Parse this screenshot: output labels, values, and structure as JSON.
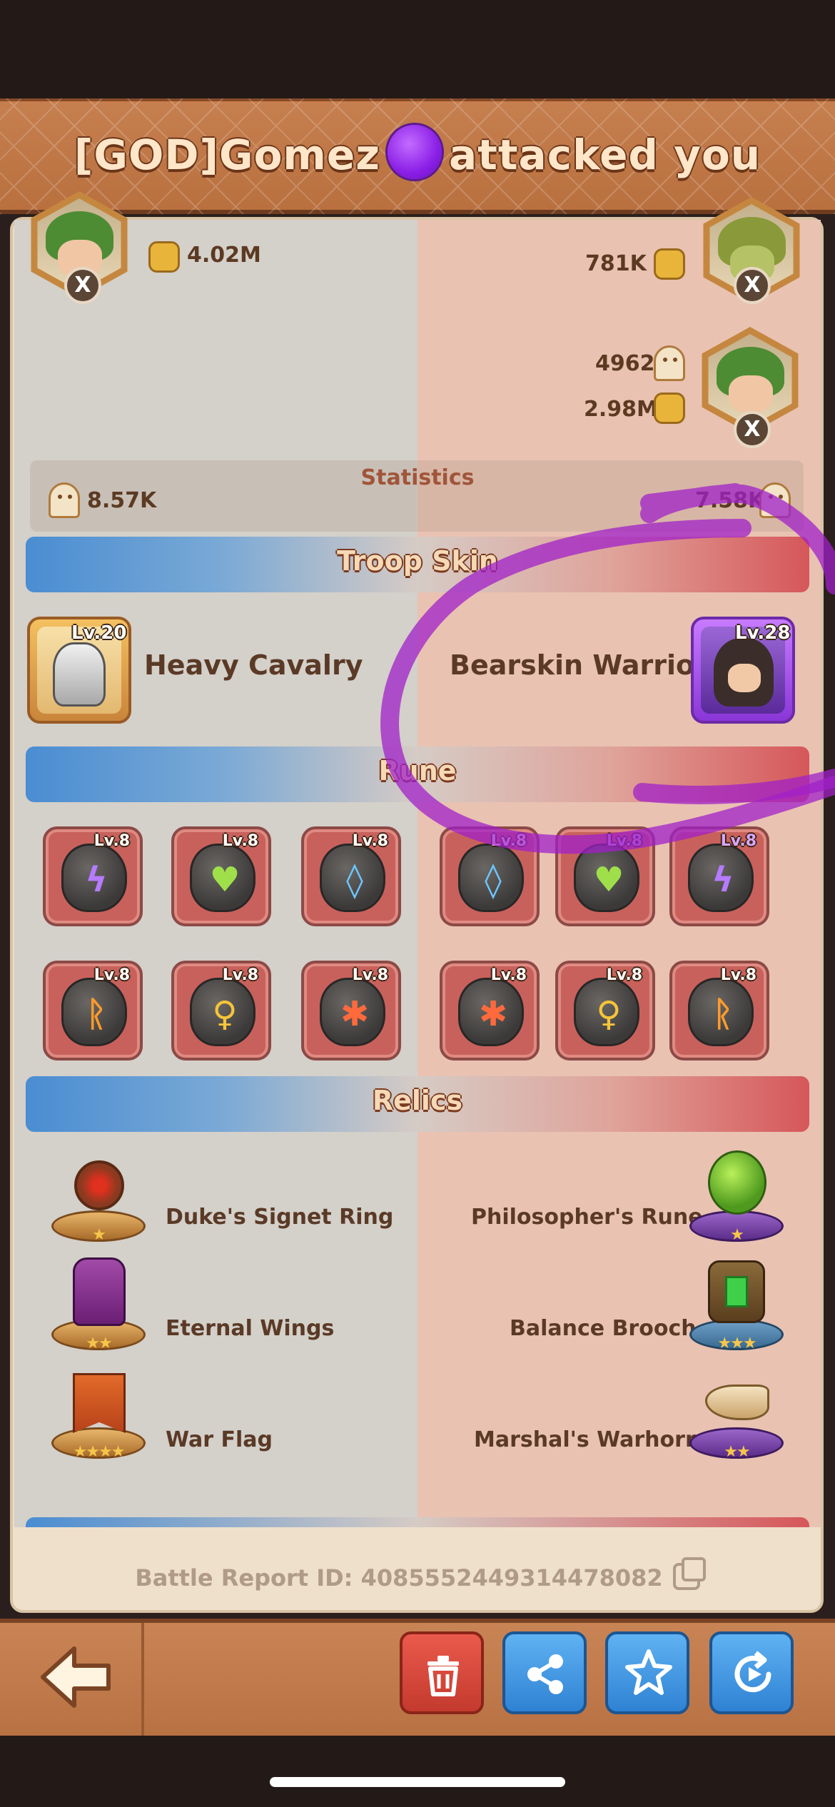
{
  "header": {
    "title_prefix": "[GOD]Gomez",
    "title_suffix": "attacked you"
  },
  "attacker_hero": {
    "power": "4.02M"
  },
  "defender_heroes": [
    {
      "power": "781K"
    },
    {
      "troops": "4962",
      "power": "2.98M"
    }
  ],
  "statistics": {
    "title": "Statistics",
    "left_value": "8.57K",
    "right_value": "7.58K"
  },
  "troop_skin": {
    "title": "Troop Skin",
    "left": {
      "level": "Lv.20",
      "name": "Heavy Cavalry"
    },
    "right": {
      "level": "Lv.28",
      "name": "Bearskin Warrior"
    }
  },
  "rune": {
    "title": "Rune",
    "level": "Lv.8",
    "left_row1": [
      "purple",
      "green",
      "blue"
    ],
    "right_row1": [
      "blue",
      "green",
      "purple"
    ],
    "left_row2": [
      "orange",
      "yellow",
      "red"
    ],
    "right_row2": [
      "red",
      "yellow",
      "orange"
    ]
  },
  "relics": {
    "title": "Relics",
    "left": [
      "Duke's Signet Ring",
      "Eternal Wings",
      "War Flag"
    ],
    "right": [
      "Philosopher's Rune",
      "Balance Brooch",
      "Marshal's Warhorn"
    ]
  },
  "footer": {
    "report_id": "Battle Report ID: 4085552449314478082"
  },
  "colors": {
    "marker": "#a020c8",
    "header": "#c67f4f",
    "rune_tile": "#c8615c"
  }
}
